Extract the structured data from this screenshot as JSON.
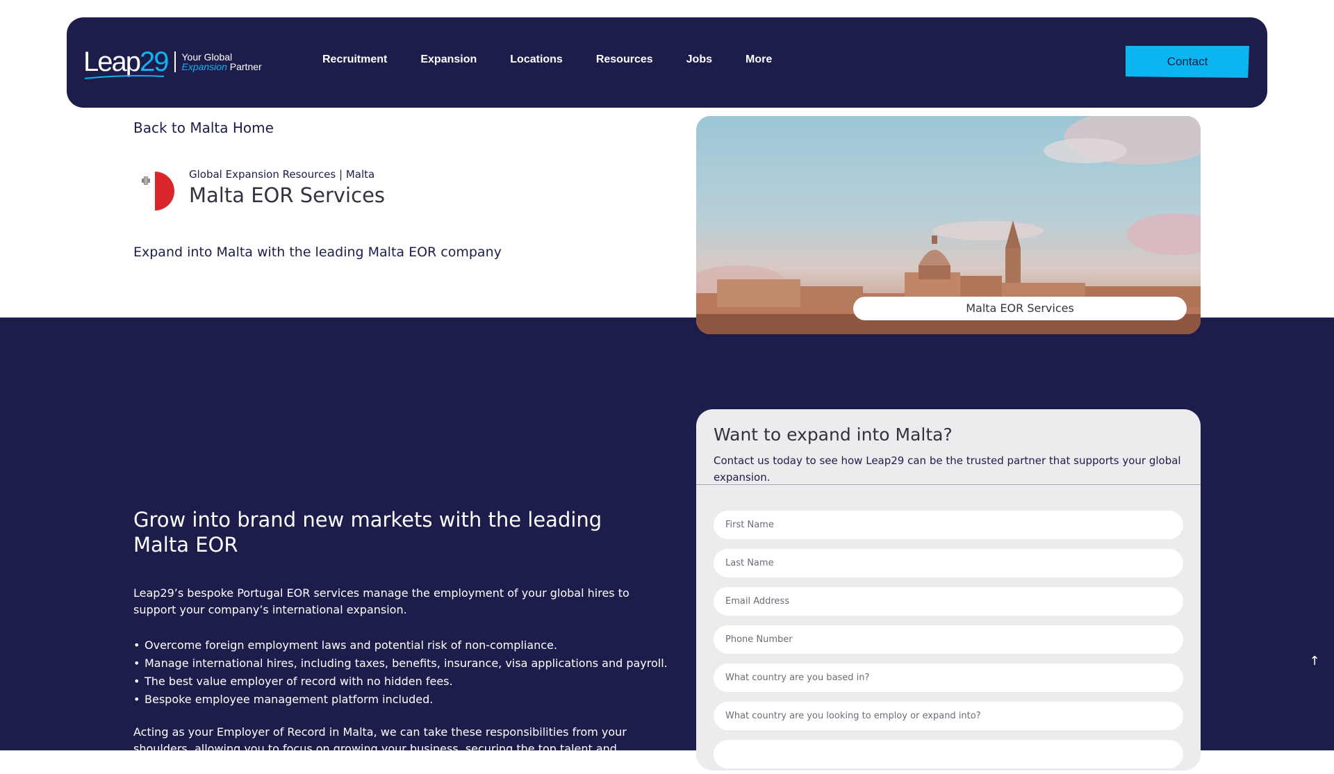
{
  "nav": {
    "logo_word": "Leap",
    "logo_num": "29",
    "tag_line1": "Your Global",
    "tag_expansion": "Expansion",
    "tag_partner": "Partner",
    "items": [
      {
        "label": "Recruitment"
      },
      {
        "label": "Expansion"
      },
      {
        "label": "Locations"
      },
      {
        "label": "Resources"
      },
      {
        "label": "Jobs"
      },
      {
        "label": "More"
      }
    ],
    "contact_label": "Contact"
  },
  "hero": {
    "back_link": "Back to Malta Home",
    "eyebrow": "Global Expansion Resources | Malta",
    "title": "Malta EOR Services",
    "tagline": "Expand into Malta with the leading Malta EOR company",
    "image_caption": "Malta EOR Services"
  },
  "content": {
    "heading": "Grow into brand new markets with the leading Malta EOR",
    "intro": "Leap29’s bespoke Portugal EOR services manage the employment of your global hires to support your company’s international expansion.",
    "bullets": [
      "Overcome foreign employment laws and potential risk of non-compliance.",
      "Manage international hires, including taxes, benefits, insurance, visa applications and payroll.",
      "The best value employer of record with no hidden fees.",
      "Bespoke employee management platform included."
    ],
    "outro": "Acting as your Employer of Record in Malta, we can take these responsibilities from your shoulders, allowing you to focus on growing your business, securing the top talent and winning"
  },
  "form": {
    "title": "Want to expand into Malta?",
    "subtitle": "Contact us today to see how Leap29 can be the trusted partner that supports your global expansion.",
    "fields": {
      "first_name": "First Name",
      "last_name": "Last Name",
      "email": "Email Address",
      "phone": "Phone Number",
      "based_in": "What country are you based in?",
      "expand_into": "What country are you looking to employ or expand into?"
    }
  },
  "scroll_top": "↑",
  "colors": {
    "navy": "#1d1d4b",
    "accent": "#0cb4f0",
    "flag_red": "#d9262c",
    "form_bg": "#ecebee"
  },
  "icons": {
    "flag": "malta-flag-icon",
    "scroll_top": "arrow-up-icon"
  }
}
